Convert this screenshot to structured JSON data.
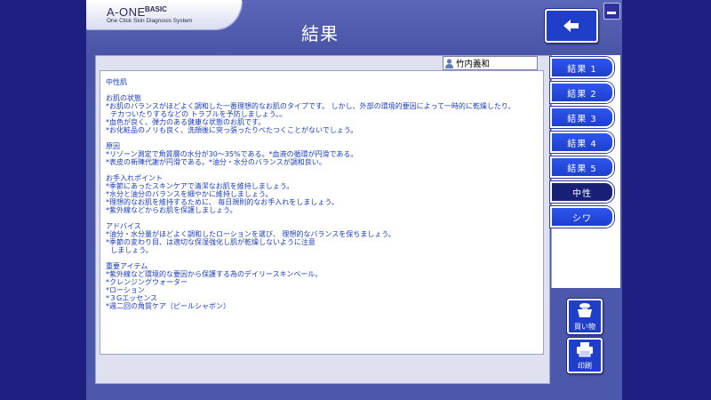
{
  "app": {
    "logo_title": "A-ONE",
    "logo_edition": "BASIC",
    "logo_subtitle": "One Click Skin Diagnosis System"
  },
  "header": {
    "title": "結果",
    "back_icon": "arrow-left-icon"
  },
  "user": {
    "name": "竹内義和",
    "icon": "person-icon"
  },
  "result": {
    "lines": [
      "中性肌",
      "",
      "お肌の状態",
      "*お肌のバランスがほどよく調和した一番理想的なお肌のタイプです。 しかし、外部の環境的要因によって一時的に乾燥したり、",
      "  テカついたりするなどの トラブルを予防しましょう。。",
      "*血色が良く、弾力のある健康な状態のお肌です。",
      "*お化粧品のノリも良く、洗顔後に突っ張ったりべたつくことがないでしょう。",
      "",
      "原因",
      "*リゾーン測定で角質層の水分が30～35%である。*血液の循環が円滑である。",
      "*表皮の新陳代謝が円滑である。*油分・水分のバランスが調和良い。",
      "",
      "お手入れポイント",
      "*季節にあったスキンケアで清潔なお肌を維持しましょう。",
      "*水分と油分のバランスを細やかに維持しましょう。",
      "*理想的なお肌を維持するために、 毎日規則的なお手入れをしましょう。",
      "*紫外線などからお肌を保護しましょう。",
      "",
      "アドバイス",
      "*油分・水分量がほどよく調和したローションを選び、 理想的なバランスを保ちましょう。",
      "*季節の変わり目、は適切な保湿強化し肌が乾燥しないように注意",
      "  しましょう。",
      "",
      "重要アイテム",
      "*紫外線など環境的な要因から保護する為のデイリースキンベール。",
      "*クレンジングウォーター",
      "*ローション",
      "*３Gエッセンス",
      "*週二回の角質ケア（ピールシャボン）"
    ]
  },
  "sidebar": {
    "tabs": [
      {
        "label": "結果 1",
        "state": "normal"
      },
      {
        "label": "結果 2",
        "state": "normal"
      },
      {
        "label": "結果 3",
        "state": "normal"
      },
      {
        "label": "結果 4",
        "state": "normal"
      },
      {
        "label": "結果 5",
        "state": "normal"
      },
      {
        "label": "中性",
        "state": "active"
      },
      {
        "label": "シワ",
        "state": "normal"
      }
    ]
  },
  "actions": {
    "buy_label": "買い物",
    "buy_icon": "shopping-bag-icon",
    "print_label": "印刷",
    "print_icon": "printer-icon"
  },
  "colors": {
    "background": "#1f1f82",
    "app_panel": "#4c58ab",
    "button_blue": "#1f3fc8",
    "active_tab": "#182078",
    "result_text": "#1a3cc0"
  }
}
